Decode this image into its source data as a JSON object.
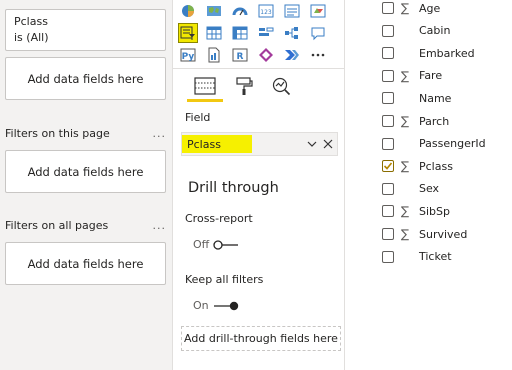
{
  "filters_pane": {
    "pclass_card": {
      "field": "Pclass",
      "state": "is (All)"
    },
    "drop_visual": "Add data fields here",
    "this_page": {
      "title": "Filters on this page",
      "more": "...",
      "drop": "Add data fields here"
    },
    "all_pages": {
      "title": "Filters on all pages",
      "more": "...",
      "drop": "Add data fields here"
    }
  },
  "visualizations_pane": {
    "icons": [
      "pie-chart-icon",
      "map-icon",
      "gauge-icon",
      "card-icon",
      "multirow-card-icon",
      "kpi-icon",
      "slicer-icon",
      "table-icon",
      "matrix-icon",
      "key-influencers-icon",
      "decomposition-tree-icon",
      "qa-icon",
      "python-visual-icon",
      "paginated-report-icon",
      "r-visual-icon",
      "power-apps-icon",
      "power-automate-icon",
      "more-icon"
    ],
    "selected_icon": "slicer-icon",
    "tools": [
      "fields-tool-icon",
      "format-tool-icon",
      "analytics-tool-icon"
    ],
    "field_label": "Field",
    "field_value": "Pclass",
    "drill_title": "Drill through",
    "cross_report_label": "Cross-report",
    "cross_report_state": "Off",
    "keep_filters_label": "Keep all filters",
    "keep_filters_state": "On",
    "add_drill": "Add drill-through fields here"
  },
  "fields_pane": {
    "rows": [
      {
        "name": "Age",
        "sigma": "∑",
        "checked": false
      },
      {
        "name": "Cabin",
        "sigma": "",
        "checked": false
      },
      {
        "name": "Embarked",
        "sigma": "",
        "checked": false
      },
      {
        "name": "Fare",
        "sigma": "∑",
        "checked": false
      },
      {
        "name": "Name",
        "sigma": "",
        "checked": false
      },
      {
        "name": "Parch",
        "sigma": "∑",
        "checked": false
      },
      {
        "name": "PassengerId",
        "sigma": "",
        "checked": false
      },
      {
        "name": "Pclass",
        "sigma": "∑",
        "checked": true
      },
      {
        "name": "Sex",
        "sigma": "",
        "checked": false
      },
      {
        "name": "SibSp",
        "sigma": "∑",
        "checked": false
      },
      {
        "name": "Survived",
        "sigma": "∑",
        "checked": false
      },
      {
        "name": "Ticket",
        "sigma": "",
        "checked": false
      }
    ]
  },
  "colors": {
    "accent_yellow": "#f2c811",
    "highlight": "#f6f000",
    "check": "#b38600"
  }
}
